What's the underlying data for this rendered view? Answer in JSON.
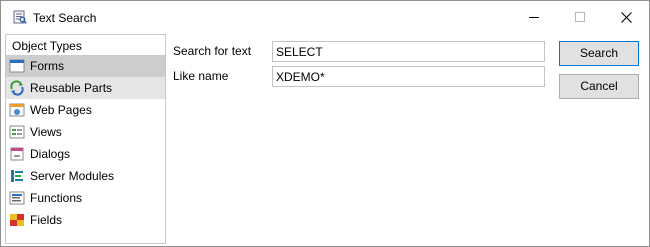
{
  "window": {
    "title": "Text Search",
    "icon": "text-search-app-icon",
    "controls": [
      "minimize-icon",
      "maximize-icon",
      "close-icon"
    ]
  },
  "object_types": {
    "header": "Object Types",
    "selected": "Forms",
    "hovered": "Reusable Parts",
    "items": [
      {
        "label": "Forms",
        "icon": "forms-icon"
      },
      {
        "label": "Reusable Parts",
        "icon": "reusable-parts-icon"
      },
      {
        "label": "Web Pages",
        "icon": "web-pages-icon"
      },
      {
        "label": "Views",
        "icon": "views-icon"
      },
      {
        "label": "Dialogs",
        "icon": "dialogs-icon"
      },
      {
        "label": "Server Modules",
        "icon": "server-modules-icon"
      },
      {
        "label": "Functions",
        "icon": "functions-icon"
      },
      {
        "label": "Fields",
        "icon": "fields-icon"
      }
    ]
  },
  "search": {
    "text_label": "Search for text",
    "text_value": "SELECT",
    "name_label": "Like name",
    "name_value": "XDEMO*"
  },
  "buttons": {
    "search": "Search",
    "cancel": "Cancel"
  },
  "colors": {
    "selection": "#cdcdcd",
    "hover": "#e5e5e5",
    "default_button_border": "#0078d7",
    "button_face": "#e1e1e1"
  }
}
